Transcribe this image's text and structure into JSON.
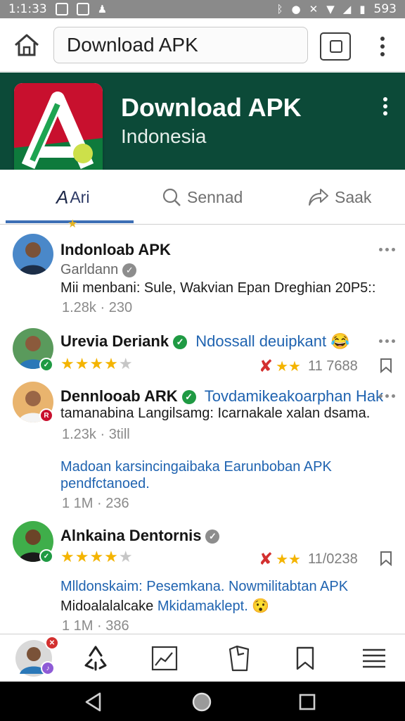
{
  "status_bar": {
    "time": "1:1:33",
    "battery": "593",
    "left_icons": [
      "notification-box-icon",
      "app-n-icon",
      "person-icon"
    ],
    "right_icons": [
      "bluetooth-icon",
      "location-icon",
      "mute-icon",
      "wifi-icon",
      "signal-icon",
      "battery-icon"
    ]
  },
  "url_bar": {
    "url": "Download APK"
  },
  "header": {
    "title": "Download APK",
    "subtitle": "Indonesia"
  },
  "tabs": [
    {
      "label": "Ari",
      "icon": "ari-icon",
      "active": true
    },
    {
      "label": "Sennad",
      "icon": "search-icon",
      "active": false
    },
    {
      "label": "Saak",
      "icon": "share-icon",
      "active": false
    }
  ],
  "feed": [
    {
      "name": "Indonloab APK",
      "handle": "Garldann",
      "verified": "grey",
      "text": "Mii menbani: Sule, Wakvian Epan Dreghian 20P5::",
      "meta": "1.28k · 230"
    },
    {
      "name": "Urevia Deriank",
      "verified": "green",
      "inline_link": "Ndossall deuipkant",
      "rating": 4,
      "rating_text": "11 7688"
    },
    {
      "name": "Dennlooab ARK",
      "verified": "green",
      "inline_link": "Tovdamikeakoarphan Hak",
      "text": "tamanabina Langilsamg: Icarnakale xalan dsama.",
      "meta": "1.23k · 3till",
      "link_line1": "Madoan karsincingaibaka Earunboban APK",
      "link_line2": "pendfctanoed.",
      "meta2": "1 1M · 236"
    },
    {
      "name": "Alnkaina Dentornis",
      "verified": "grey",
      "rating": 4,
      "rating_text": "11/0238",
      "link_line1": "Mlldonskaim: Pesemkana. Nowmilitabtan APK",
      "text_prefix": "Midoalalalcake",
      "text_link": "Mkidamaklept.",
      "meta": "1 1M · 386"
    }
  ],
  "bottom_nav": [
    "profile-avatar",
    "sync-icon",
    "chart-icon",
    "bag-icon",
    "bookmark-icon",
    "menu-icon"
  ],
  "system_nav": [
    "back-icon",
    "home-icon",
    "recents-icon"
  ],
  "colors": {
    "banner": "#0c4a38",
    "accent": "#3d6fb5",
    "link": "#1f63b0",
    "verified": "#1f9a43",
    "star": "#f4b400"
  }
}
